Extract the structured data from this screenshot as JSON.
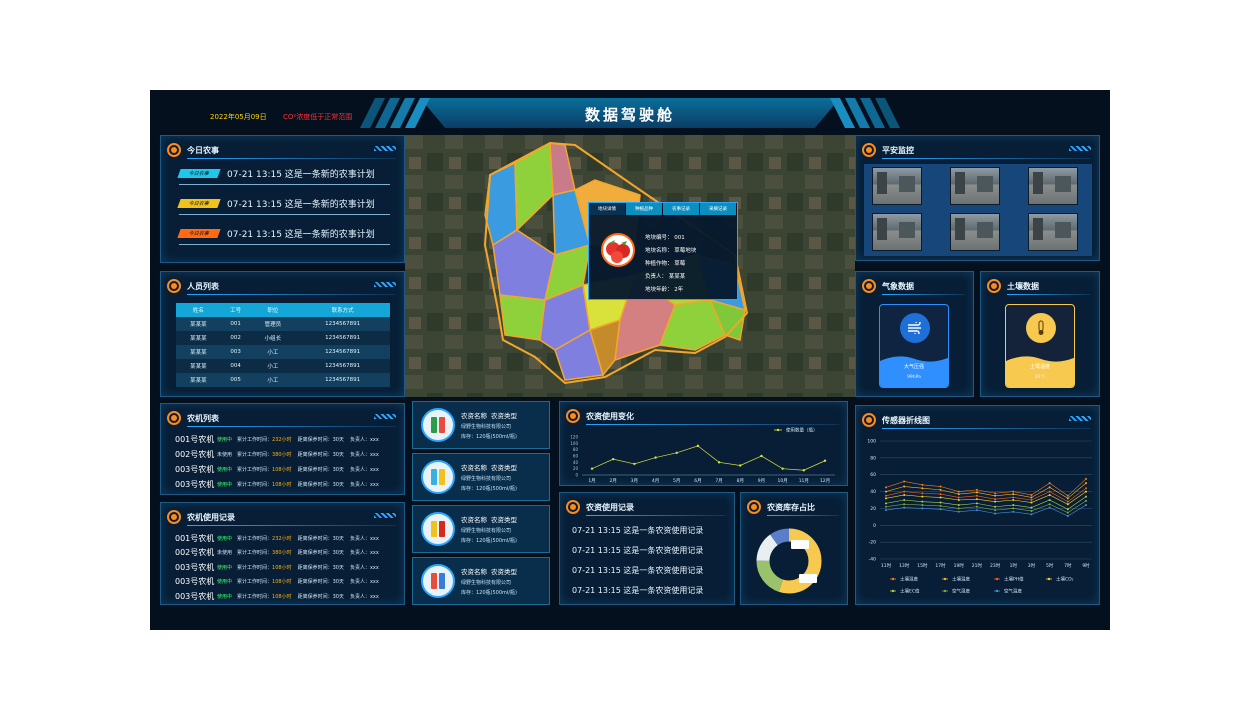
{
  "header": {
    "title": "数据驾驶舱",
    "date": "2022年05月09日",
    "alert": "CO²浓度低于正常范围"
  },
  "farm_tasks": {
    "title": "今日农事",
    "items": [
      {
        "tag": "今日农事",
        "tag_color": "#1fc8e8",
        "text": "07-21 13:15  这是一条新的农事计划"
      },
      {
        "tag": "今日农事",
        "tag_color": "#f1c21b",
        "text": "07-21 13:15  这是一条新的农事计划"
      },
      {
        "tag": "今日农事",
        "tag_color": "#ff6a13",
        "text": "07-21 13:15  这是一条新的农事计划"
      }
    ]
  },
  "personnel": {
    "title": "人员列表",
    "headers": [
      "姓名",
      "工号",
      "职位",
      "联系方式"
    ],
    "rows": [
      [
        "某某某",
        "001",
        "管理员",
        "1234567891"
      ],
      [
        "某某某",
        "002",
        "小组长",
        "1234567891"
      ],
      [
        "某某某",
        "003",
        "小工",
        "1234567891"
      ],
      [
        "某某某",
        "004",
        "小工",
        "1234567891"
      ],
      [
        "某某某",
        "005",
        "小工",
        "1234567891"
      ]
    ]
  },
  "machines": {
    "title": "农机列表",
    "rows": [
      {
        "name": "001号农机",
        "status": "使用中",
        "status_color": "#3cff6a",
        "hours_label": "累计工作时间：",
        "hours": "232小时",
        "maint": "距离保养时间：30天",
        "person": "负责人：xxx"
      },
      {
        "name": "002号农机",
        "status": "未使用",
        "status_color": "#cfe6f7",
        "hours_label": "累计工作时间：",
        "hours": "380小时",
        "maint": "距离保养时间：30天",
        "person": "负责人：xxx"
      },
      {
        "name": "003号农机",
        "status": "使用中",
        "status_color": "#3cff6a",
        "hours_label": "累计工作时间：",
        "hours": "108小时",
        "maint": "距离保养时间：30天",
        "person": "负责人：xxx"
      },
      {
        "name": "003号农机",
        "status": "使用中",
        "status_color": "#3cff6a",
        "hours_label": "累计工作时间：",
        "hours": "108小时",
        "maint": "距离保养时间：30天",
        "person": "负责人：xxx"
      }
    ]
  },
  "machine_usage": {
    "title": "农机使用记录",
    "rows": [
      {
        "name": "001号农机",
        "status": "使用中",
        "status_color": "#3cff6a",
        "hours_label": "累计工作时间：",
        "hours": "232小时",
        "maint": "距离保养时间：30天",
        "person": "负责人：xxx"
      },
      {
        "name": "002号农机",
        "status": "未使用",
        "status_color": "#cfe6f7",
        "hours_label": "累计工作时间：",
        "hours": "380小时",
        "maint": "距离保养时间：30天",
        "person": "负责人：xxx"
      },
      {
        "name": "003号农机",
        "status": "使用中",
        "status_color": "#3cff6a",
        "hours_label": "累计工作时间：",
        "hours": "108小时",
        "maint": "距离保养时间：30天",
        "person": "负责人：xxx"
      },
      {
        "name": "003号农机",
        "status": "使用中",
        "status_color": "#3cff6a",
        "hours_label": "累计工作时间：",
        "hours": "108小时",
        "maint": "距离保养时间：30天",
        "person": "负责人：xxx"
      },
      {
        "name": "003号农机",
        "status": "使用中",
        "status_color": "#3cff6a",
        "hours_label": "累计工作时间：",
        "hours": "108小时",
        "maint": "距离保养时间：30天",
        "person": "负责人：xxx"
      }
    ]
  },
  "pesticides": [
    {
      "name": "农资名称",
      "type": "农资类型",
      "company": "绿野生物科技有限公司",
      "stock": "库存：120瓶(500ml/瓶)"
    },
    {
      "name": "农资名称",
      "type": "农资类型",
      "company": "绿野生物科技有限公司",
      "stock": "库存：120瓶(500ml/瓶)"
    },
    {
      "name": "农资名称",
      "type": "农资类型",
      "company": "绿野生物科技有限公司",
      "stock": "库存：120瓶(500ml/瓶)"
    },
    {
      "name": "农资名称",
      "type": "农资类型",
      "company": "绿野生物科技有限公司",
      "stock": "库存：120瓶(500ml/瓶)"
    }
  ],
  "map_popup": {
    "tabs": [
      "地块详情",
      "种植品种",
      "农事记录",
      "采摘记录"
    ],
    "plot_no": "地块编号：  001",
    "plot_name": "地块名称：  草莓地块",
    "crop": "种植作物：  草莓",
    "manager": "负责人：  某某某",
    "age": "地块年龄：  2年"
  },
  "usage_records": {
    "title": "农资使用记录",
    "items": [
      "07-21 13:15  这是一条农资使用记录",
      "07-21 13:15  这是一条农资使用记录",
      "07-21 13:15  这是一条农资使用记录",
      "07-21 13:15  这是一条农资使用记录"
    ]
  },
  "monitor": {
    "title": "平安监控"
  },
  "weather": {
    "title": "气象数据",
    "label": "大气压强",
    "value": "99hPa",
    "color": "#2f8fff"
  },
  "soil": {
    "title": "土壤数据",
    "label": "土壤温度",
    "value": "20℃",
    "color": "#f7c94e"
  },
  "inventory": {
    "title": "农资库存占比"
  },
  "chart_data": [
    {
      "type": "line",
      "title": "农资使用变化",
      "series": [
        {
          "name": "使用数量（瓶）",
          "color": "#d8e23a",
          "values": [
            20,
            50,
            35,
            55,
            70,
            92,
            40,
            30,
            60,
            20,
            15,
            45
          ]
        }
      ],
      "categories": [
        "1月",
        "2月",
        "3月",
        "4月",
        "5月",
        "6月",
        "7月",
        "8月",
        "9月",
        "10月",
        "11月",
        "12月"
      ],
      "ylim": [
        0,
        120
      ],
      "yticks": [
        0,
        20,
        40,
        60,
        80,
        100,
        120
      ]
    },
    {
      "type": "line",
      "title": "传感器折线图",
      "categories": [
        "11时",
        "13时",
        "15时",
        "17时",
        "19时",
        "21时",
        "23时",
        "1时",
        "3时",
        "5时",
        "7时",
        "9时"
      ],
      "ylim": [
        -40,
        100
      ],
      "yticks": [
        -40,
        -20,
        0,
        20,
        40,
        60,
        80,
        100
      ],
      "series": [
        {
          "name": "土壤湿度",
          "color": "#ff7a1a",
          "values": [
            45,
            52,
            48,
            46,
            40,
            42,
            38,
            40,
            36,
            50,
            35,
            55
          ]
        },
        {
          "name": "土壤温度",
          "color": "#ffb21a",
          "values": [
            40,
            46,
            44,
            42,
            37,
            39,
            35,
            37,
            33,
            45,
            32,
            50
          ]
        },
        {
          "name": "土壤PH值",
          "color": "#ff5a1a",
          "values": [
            35,
            40,
            38,
            37,
            33,
            35,
            31,
            33,
            30,
            40,
            28,
            44
          ]
        },
        {
          "name": "土壤CO₂",
          "color": "#ffd21a",
          "values": [
            32,
            36,
            34,
            33,
            30,
            31,
            28,
            30,
            27,
            36,
            25,
            40
          ]
        },
        {
          "name": "土壤EC值",
          "color": "#b0d24a",
          "values": [
            26,
            30,
            28,
            27,
            24,
            26,
            22,
            24,
            21,
            30,
            19,
            34
          ]
        },
        {
          "name": "空气湿度",
          "color": "#7fa84a",
          "values": [
            22,
            25,
            24,
            23,
            20,
            22,
            18,
            20,
            17,
            25,
            15,
            29
          ]
        },
        {
          "name": "空气温度",
          "color": "#4a8fd2",
          "values": [
            18,
            21,
            20,
            19,
            16,
            18,
            14,
            16,
            13,
            21,
            11,
            24
          ]
        }
      ]
    },
    {
      "type": "pie",
      "title": "农资库存占比",
      "series": [
        {
          "values": [
            55,
            20,
            15,
            10
          ],
          "colors": [
            "#f7c94e",
            "#9ac26a",
            "#e8eef2",
            "#5a7fc8"
          ]
        }
      ]
    }
  ]
}
